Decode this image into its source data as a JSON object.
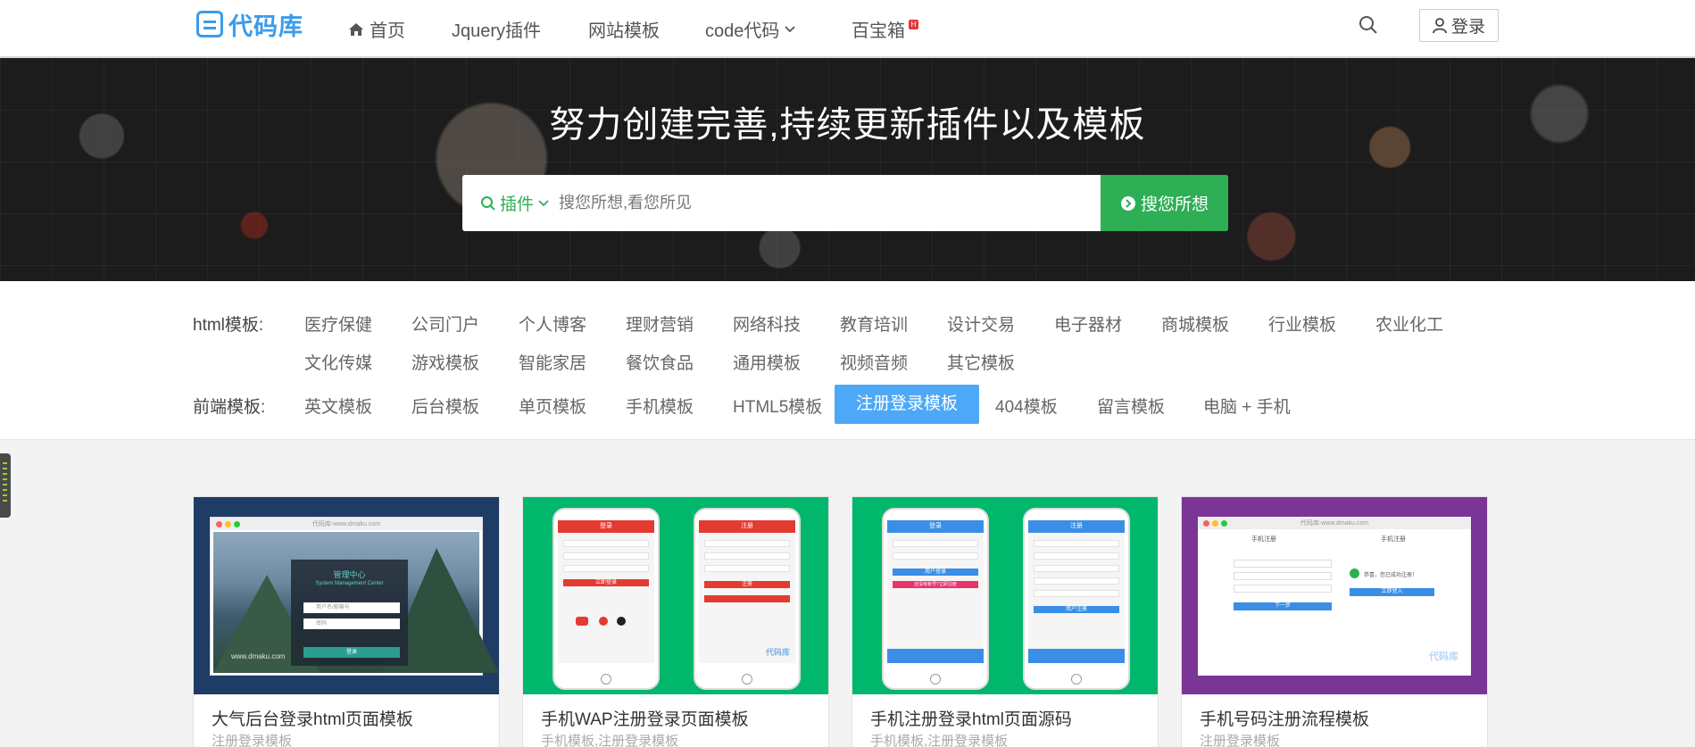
{
  "header": {
    "logo_text": "代码库",
    "nav": [
      {
        "label": "首页",
        "icon": "home-icon"
      },
      {
        "label": "Jquery插件"
      },
      {
        "label": "网站模板"
      },
      {
        "label": "code代码",
        "icon": "chevron-down-icon"
      },
      {
        "label": "百宝箱",
        "badge": "H"
      }
    ],
    "login_label": "登录"
  },
  "banner": {
    "title": "努力创建完善,持续更新插件以及模板",
    "search_type": "插件",
    "search_placeholder": "搜您所想,看您所见",
    "search_button": "搜您所想"
  },
  "filters": {
    "html_label": "html模板:",
    "html_items": [
      "医疗保健",
      "公司门户",
      "个人博客",
      "理财营销",
      "网络科技",
      "教育培训",
      "设计交易",
      "电子器材",
      "商城模板",
      "行业模板",
      "农业化工",
      "文化传媒",
      "游戏模板",
      "智能家居",
      "餐饮食品",
      "通用模板",
      "视频音频",
      "其它模板"
    ],
    "front_label": "前端模板:",
    "front_items": [
      "英文模板",
      "后台模板",
      "单页模板",
      "手机模板",
      "HTML5模板",
      "注册登录模板",
      "404模板",
      "留言模板",
      "电脑 + 手机"
    ],
    "active": "注册登录模板"
  },
  "cards": [
    {
      "title": "大气后台登录html页面模板",
      "tags": "注册登录模板",
      "thumb": {
        "url": "代码库-www.dmaku.com",
        "panel_title": "管理中心",
        "panel_sub": "System Management Center",
        "field1": "用户名/邮箱号",
        "field2": "密码",
        "button": "登录",
        "watermark": "www.dmaku.com"
      }
    },
    {
      "title": "手机WAP注册登录页面模板",
      "tags": "手机模板,注册登录模板",
      "thumb": {
        "left_title": "登录",
        "right_title": "注册",
        "login_btn": "立即登录",
        "reg_btn": "注册",
        "watermark": "代码库"
      }
    },
    {
      "title": "手机注册登录html页面源码",
      "tags": "手机模板,注册登录模板",
      "thumb": {
        "left_title": "登录",
        "right_title": "注册",
        "btn1": "用户登录",
        "btn2": "还没有帐号?立即注册",
        "btn3": "用户注册"
      }
    },
    {
      "title": "手机号码注册流程模板",
      "tags": "注册登录模板",
      "thumb": {
        "url": "代码库-www.dmaku.com",
        "left_head": "手机注册",
        "right_head": "手机注册",
        "success": "恭喜，您已成功注册！",
        "next": "下一步",
        "login": "立即登入",
        "watermark": "代码库"
      }
    }
  ],
  "colors": {
    "accent_green": "#2eae55",
    "active_blue": "#4da9f7",
    "logo_blue": "#3b9bea",
    "badge_red": "#e23b3b"
  }
}
